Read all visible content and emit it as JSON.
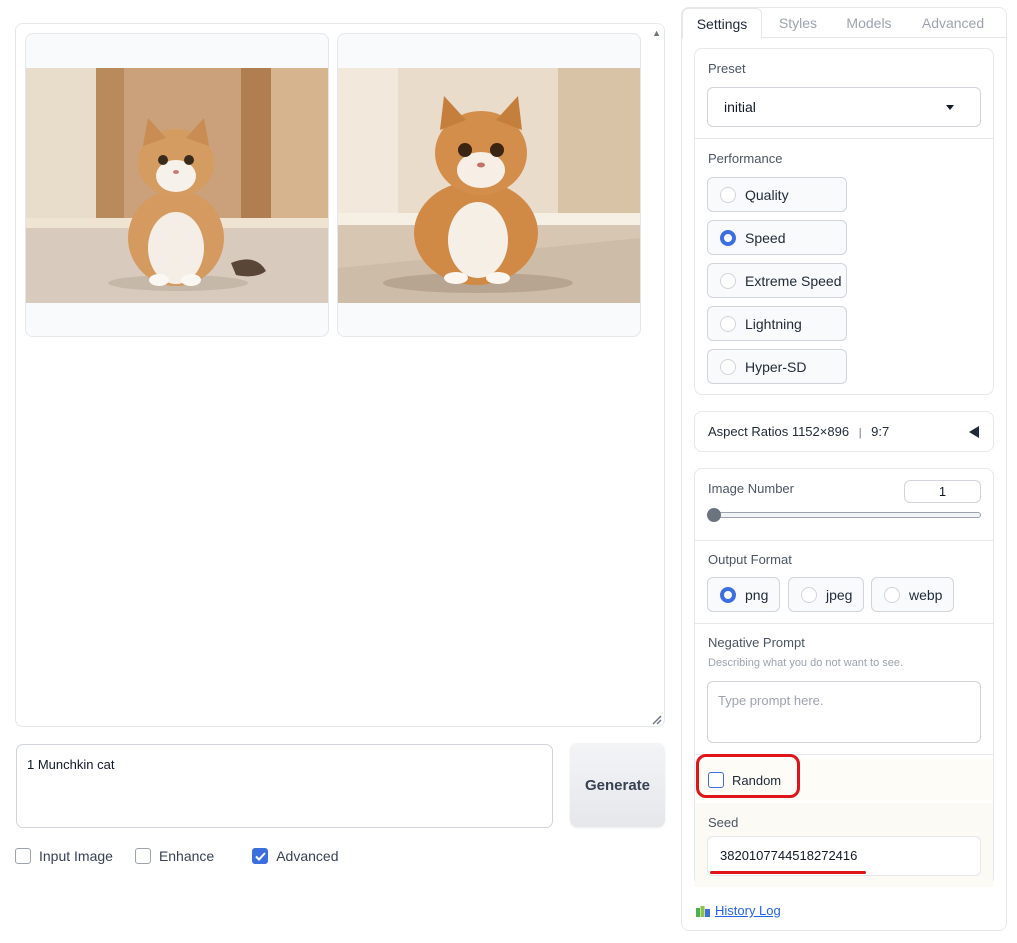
{
  "gallery": {
    "images": [
      {
        "icon": "cat-photo-1"
      },
      {
        "icon": "cat-photo-2"
      }
    ]
  },
  "prompt": {
    "value": "1 Munchkin cat"
  },
  "generate_label": "Generate",
  "options": {
    "input_image": {
      "label": "Input Image",
      "checked": false
    },
    "enhance": {
      "label": "Enhance",
      "checked": false
    },
    "advanced": {
      "label": "Advanced",
      "checked": true
    }
  },
  "tabs": [
    {
      "label": "Settings",
      "active": true
    },
    {
      "label": "Styles",
      "active": false
    },
    {
      "label": "Models",
      "active": false
    },
    {
      "label": "Advanced",
      "active": false
    }
  ],
  "preset": {
    "label": "Preset",
    "value": "initial"
  },
  "performance": {
    "label": "Performance",
    "options": [
      {
        "label": "Quality",
        "selected": false
      },
      {
        "label": "Speed",
        "selected": true
      },
      {
        "label": "Extreme Speed",
        "selected": false
      },
      {
        "label": "Lightning",
        "selected": false
      },
      {
        "label": "Hyper-SD",
        "selected": false
      }
    ]
  },
  "aspect_ratios": {
    "label": "Aspect Ratios 1152×896",
    "separator": "|",
    "ratio": "9:7"
  },
  "image_number": {
    "label": "Image Number",
    "value": "1",
    "fraction": 0.0
  },
  "output_format": {
    "label": "Output Format",
    "options": [
      {
        "label": "png",
        "selected": true
      },
      {
        "label": "jpeg",
        "selected": false
      },
      {
        "label": "webp",
        "selected": false
      }
    ]
  },
  "negative_prompt": {
    "label": "Negative Prompt",
    "hint": "Describing what you do not want to see.",
    "placeholder": "Type prompt here."
  },
  "random": {
    "label": "Random",
    "checked": false
  },
  "seed": {
    "label": "Seed",
    "value": "3820107744518272416"
  },
  "history_log": {
    "label": "History Log"
  },
  "colors": {
    "accent": "#3b6fe0",
    "annotation": "#e0151a",
    "link": "#2563eb"
  }
}
